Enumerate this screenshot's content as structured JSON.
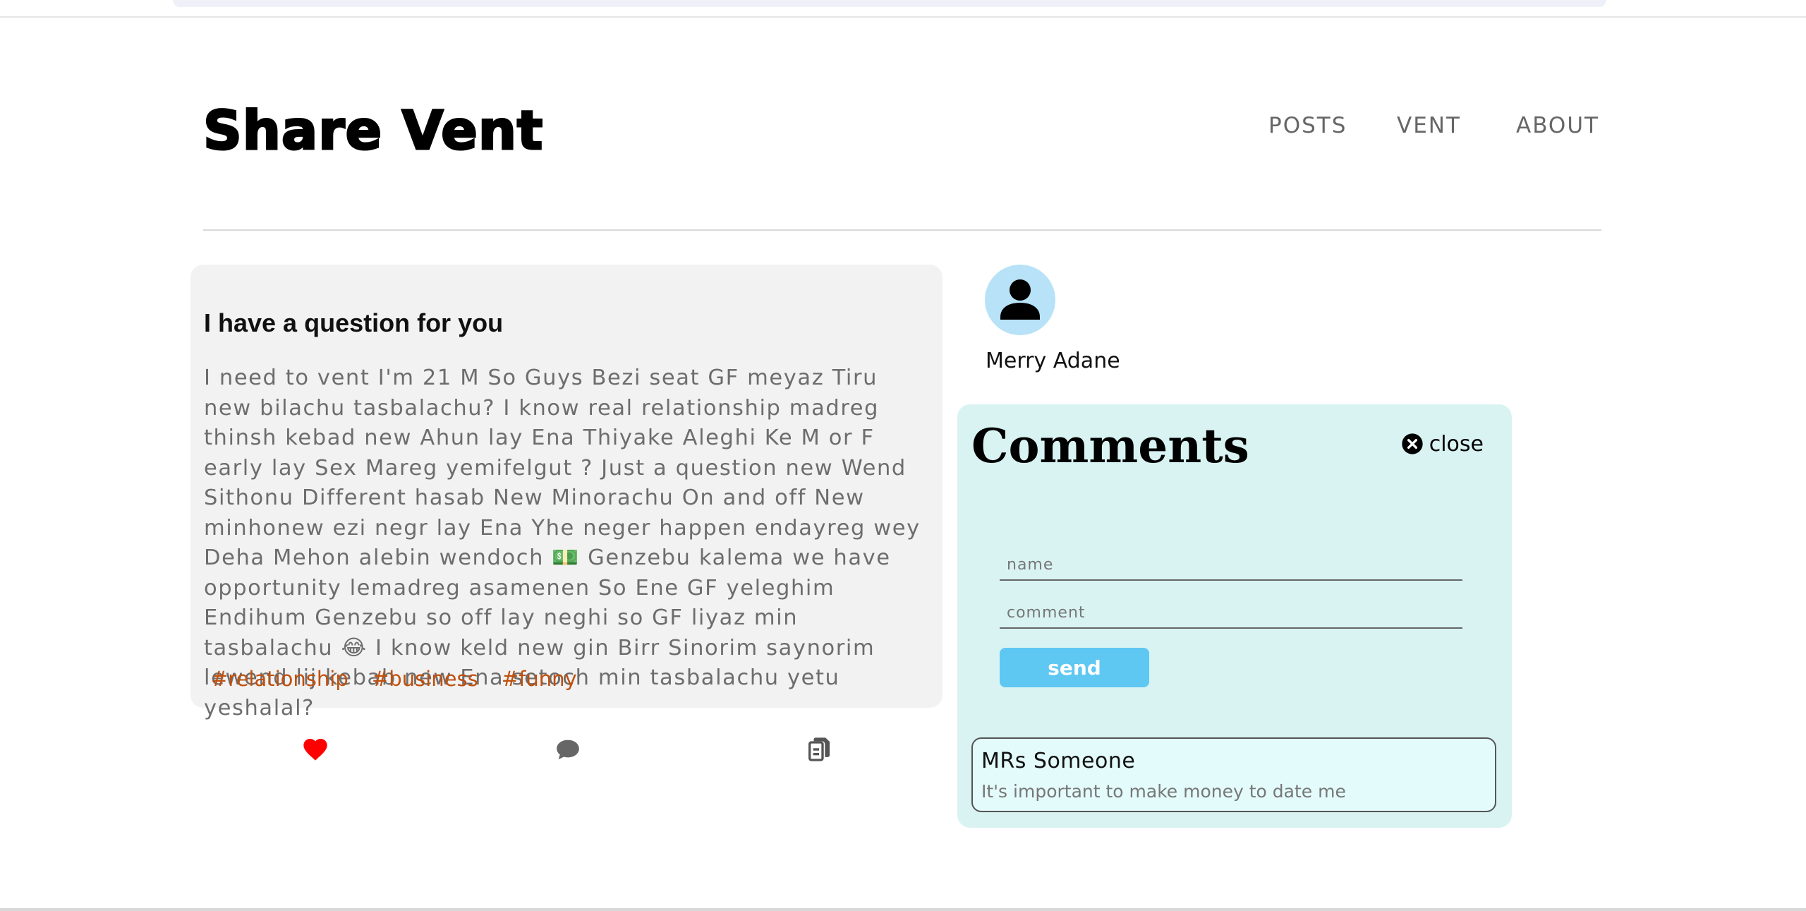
{
  "header": {
    "logo": "Share Vent",
    "nav": [
      "POSTS",
      "VENT",
      "ABOUT"
    ]
  },
  "post": {
    "title": "I have a question for you",
    "body": "I need to vent I'm 21 M So Guys Bezi seat GF meyaz Tiru new bilachu tasbalachu? I know real relationship madreg thinsh kebad new Ahun lay Ena Thiyake Aleghi Ke M or F early lay Sex Mareg yemifelgut ? Just a question new Wend Sithonu Different hasab New Minorachu On and off New minhonew ezi negr lay Ena Yhe neger happen endayreg wey Deha Mehon alebin wendoch 💵 Genzebu kalema we have opportunity lemadreg asamenen So Ene GF yeleghim Endihum Genzebu so off lay neghi so GF liyaz min tasbalachu 😂 I know keld new gin Birr Sinorim saynorim lewend lij kebab new Ena setoch min tasbalachu yetu yeshalal?",
    "tags": [
      "#relationship",
      "#business",
      "#funny"
    ],
    "actions": {
      "like_icon": "heart-icon",
      "comment_icon": "comment-icon",
      "copy_icon": "copy-icon"
    }
  },
  "user": {
    "avatar_icon": "user-icon",
    "name": "Merry Adane"
  },
  "comments": {
    "title": "Comments",
    "close_label": "close",
    "name_placeholder": "name",
    "comment_placeholder": "comment",
    "send_label": "send",
    "items": [
      {
        "author": "MRs Someone",
        "text": "It's important to make money to date me"
      }
    ]
  },
  "colors": {
    "tag": "#c0500e",
    "heart": "#ff0000",
    "panel_bg": "#d9f3f3",
    "send_button": "#5ec7f2",
    "avatar_bg": "#b7e2f8"
  }
}
